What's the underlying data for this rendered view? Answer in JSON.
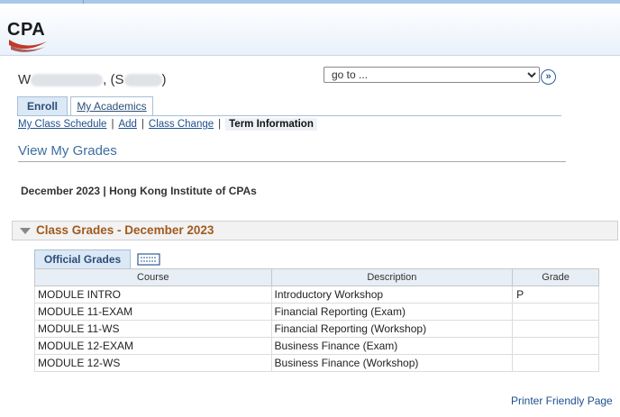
{
  "header": {
    "logo_text": "CPA"
  },
  "user": {
    "name_prefix": "W",
    "name_mid": ", (S",
    "name_suffix": ")"
  },
  "goto": {
    "selected": "go to ...",
    "button": "»"
  },
  "tabs": [
    {
      "label": "Enroll"
    },
    {
      "label": "My Academics"
    }
  ],
  "subnav": {
    "items": [
      "My Class Schedule",
      "Add",
      "Class Change"
    ],
    "current": "Term Information",
    "sep": "|"
  },
  "page": {
    "title": "View My Grades",
    "term": "December 2023 | Hong Kong Institute of CPAs"
  },
  "section": {
    "title": "Class Grades - December 2023"
  },
  "grades": {
    "tab_label": "Official Grades",
    "columns": [
      "Course",
      "Description",
      "Grade"
    ],
    "rows": [
      [
        "MODULE INTRO",
        "Introductory Workshop",
        "P"
      ],
      [
        "MODULE 11-EXAM",
        "Financial Reporting (Exam)",
        ""
      ],
      [
        "MODULE 11-WS",
        "Financial Reporting (Workshop)",
        ""
      ],
      [
        "MODULE 12-EXAM",
        "Business Finance (Exam)",
        ""
      ],
      [
        "MODULE 12-WS",
        "Business Finance (Workshop)",
        ""
      ]
    ]
  },
  "footer": {
    "printer_link": "Printer Friendly Page"
  }
}
